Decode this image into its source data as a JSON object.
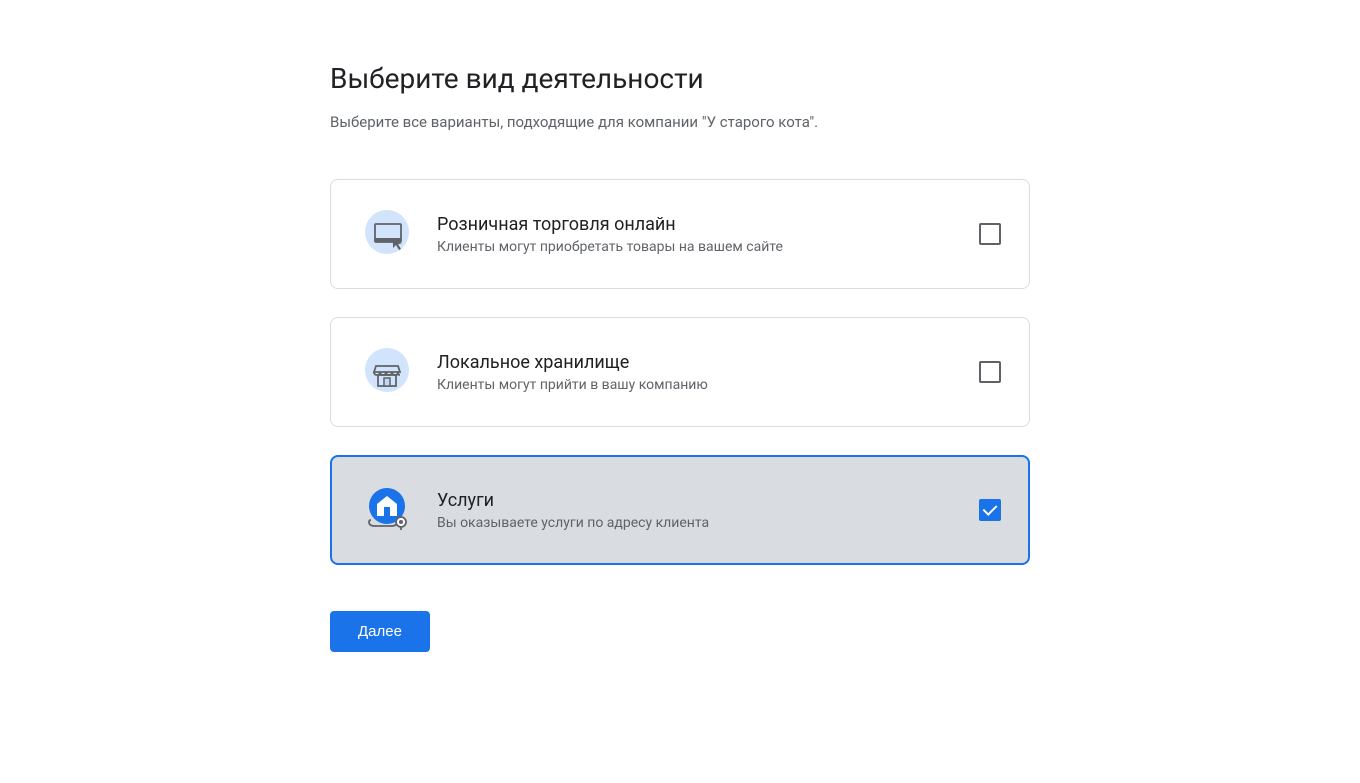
{
  "header": {
    "title": "Выберите вид деятельности",
    "subtitle": "Выберите все варианты, подходящие для компании \"У старого кота\"."
  },
  "options": [
    {
      "id": "online-retail",
      "title": "Розничная торговля онлайн",
      "description": "Клиенты могут приобретать товары на вашем сайте",
      "icon": "monitor-cursor-icon",
      "selected": false
    },
    {
      "id": "local-store",
      "title": "Локальное хранилище",
      "description": "Клиенты могут прийти в вашу компанию",
      "icon": "storefront-icon",
      "selected": false
    },
    {
      "id": "services",
      "title": "Услуги",
      "description": "Вы оказываете услуги по адресу клиента",
      "icon": "house-pin-icon",
      "selected": true
    }
  ],
  "buttons": {
    "next": "Далее"
  }
}
